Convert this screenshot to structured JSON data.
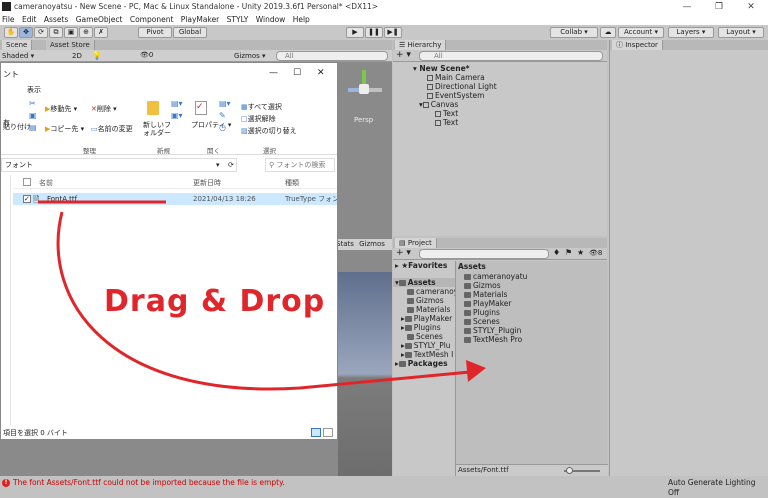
{
  "window": {
    "title": "cameranoyatsu - New Scene - PC, Mac & Linux Standalone - Unity 2019.3.6f1 Personal* <DX11>"
  },
  "menu": [
    "File",
    "Edit",
    "Assets",
    "GameObject",
    "Component",
    "PlayMaker",
    "STYLY",
    "Window",
    "Help"
  ],
  "toolbar": {
    "pivot": "Pivot",
    "global": "Global",
    "collab": "Collab",
    "account": "Account",
    "layers": "Layers",
    "layout": "Layout"
  },
  "scene": {
    "tab_scene": "Scene",
    "tab_asset_store": "Asset Store",
    "shading": "Shaded",
    "mode_2d": "2D",
    "gizmos": "Gizmos",
    "search_placeholder": "All",
    "persp": "Persp",
    "stats": "Stats",
    "gizmos2": "Gizmos",
    "fx_count": "0"
  },
  "hierarchy": {
    "tab": "Hierarchy",
    "search_placeholder": "All",
    "items": [
      "New Scene*",
      "Main Camera",
      "Directional Light",
      "EventSystem",
      "Canvas",
      "Text",
      "Text"
    ]
  },
  "inspector": {
    "tab": "Inspector"
  },
  "project": {
    "tab": "Project",
    "badge": "8",
    "favorites": "Favorites",
    "assets": "Assets",
    "tree": [
      "cameranoy",
      "Gizmos",
      "Materials",
      "PlayMaker",
      "Plugins",
      "Scenes",
      "STYLY_Plu",
      "TextMesh I"
    ],
    "packages": "Packages",
    "assets_header": "Assets",
    "asset_items": [
      "cameranoyatu",
      "Gizmos",
      "Materials",
      "PlayMaker",
      "Plugins",
      "Scenes",
      "STYLY_Plugin",
      "TextMesh Pro"
    ],
    "path": "Assets/Font.ttf",
    "auto_generate": "Auto Generate Lighting Off"
  },
  "explorer": {
    "title": "ント",
    "menu_view": "表示",
    "ribbon": {
      "paste": "貼り付け",
      "move_to": "移動先",
      "copy_to": "コピー先",
      "delete": "削除",
      "rename": "名前の変更",
      "new_folder": "新しいフォルダー",
      "properties": "プロパティ",
      "select_all": "すべて選択",
      "select_none": "選択解除",
      "invert": "選択の切り替え",
      "group_org": "整理",
      "group_new": "新規",
      "group_open": "開く",
      "group_select": "選択",
      "pin": "有"
    },
    "breadcrumb": "フォント",
    "search_placeholder": "フォントの検索",
    "columns": {
      "name": "名前",
      "date": "更新日時",
      "type": "種類"
    },
    "file": {
      "name": "FontA.ttf",
      "date": "2021/04/13 18:26",
      "type": "TrueType フォント"
    },
    "status": "項目を選択 0 バイト"
  },
  "overlay": {
    "drag_drop": "Drag & Drop"
  },
  "status_bar": {
    "message": "The font Assets/Font.ttf could not be imported because the file is empty."
  }
}
